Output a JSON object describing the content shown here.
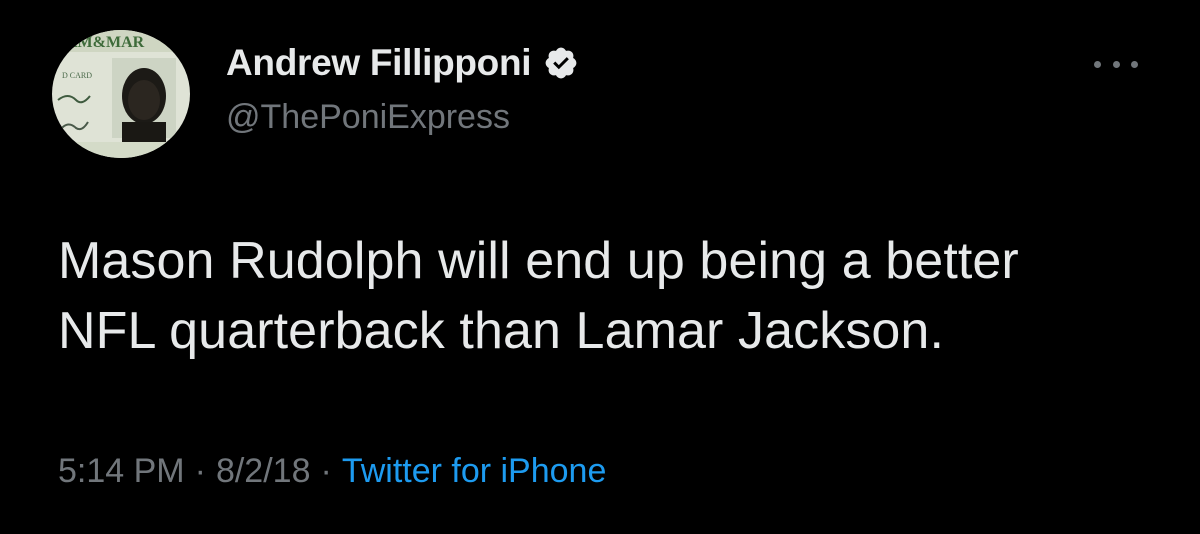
{
  "tweet": {
    "author": {
      "display_name": "Andrew Fillipponi",
      "handle": "@ThePoniExpress",
      "verified": true,
      "avatar": {
        "description_icon": "id-card-photo-avatar",
        "card_text": "AM&MAR",
        "card_label": "D CARD"
      }
    },
    "text_line_1": "Mason Rudolph will end up being a better",
    "text_line_2": "NFL quarterback than Lamar Jackson.",
    "time": "5:14 PM",
    "separator": "·",
    "date": "8/2/18",
    "source": "Twitter for iPhone",
    "more_icon": "ellipsis-icon"
  },
  "colors": {
    "background": "#000000",
    "primary_text": "#e7e9ea",
    "secondary_text": "#71767b",
    "link": "#1d9bf0",
    "verified_badge": "#e7e9ea"
  }
}
